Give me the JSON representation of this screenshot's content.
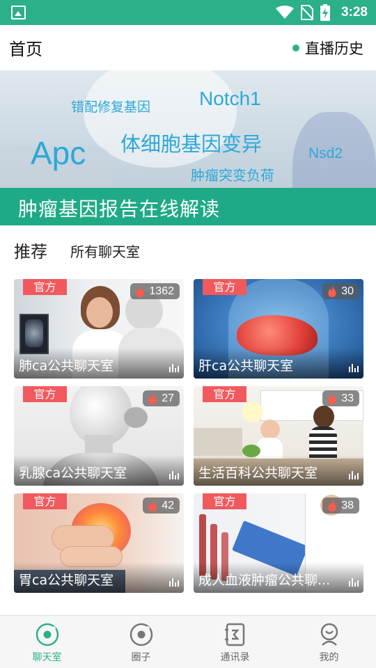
{
  "status_bar": {
    "time": "3:28"
  },
  "header": {
    "title": "首页",
    "history_label": "直播历史"
  },
  "banner": {
    "keywords": [
      "错配修复基因",
      "Notch1",
      "Apc",
      "体细胞基因变异",
      "Nsd2",
      "肿瘤突变负荷"
    ],
    "caption": "肿瘤基因报告在线解读"
  },
  "tabs": {
    "recommended": "推荐",
    "all_rooms": "所有聊天室"
  },
  "cards": [
    {
      "badge": "官方",
      "count": "1362",
      "name": "肺ca公共聊天室"
    },
    {
      "badge": "官方",
      "count": "30",
      "name": "肝ca公共聊天室"
    },
    {
      "badge": "官方",
      "count": "27",
      "name": "乳腺ca公共聊天室"
    },
    {
      "badge": "官方",
      "count": "33",
      "name": "生活百科公共聊天室"
    },
    {
      "badge": "官方",
      "count": "42",
      "name": "胃ca公共聊天室"
    },
    {
      "badge": "官方",
      "count": "38",
      "name": "成人血液肿瘤公共聊..."
    }
  ],
  "bottom_nav": [
    {
      "label": "聊天室",
      "icon": "chat-room-icon",
      "active": true
    },
    {
      "label": "圈子",
      "icon": "circle-icon",
      "active": false
    },
    {
      "label": "通讯录",
      "icon": "contacts-icon",
      "active": false
    },
    {
      "label": "我的",
      "icon": "profile-icon",
      "active": false
    }
  ],
  "colors": {
    "accent": "#2bb08a",
    "badge": "#f05a5e",
    "banner_strip": "#1faa86"
  }
}
